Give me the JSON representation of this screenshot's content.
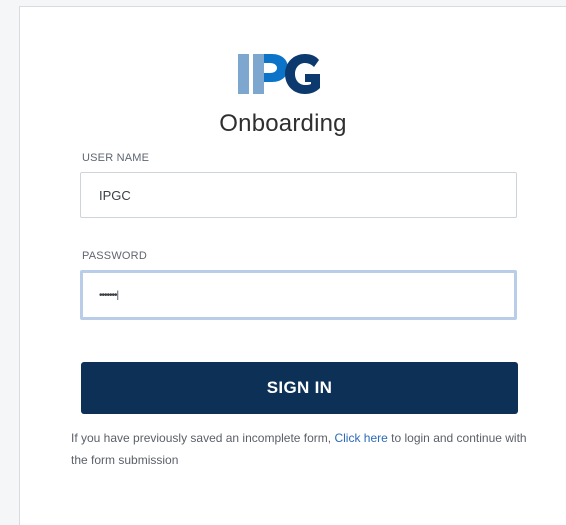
{
  "logo": {
    "text": "IPG",
    "colors": [
      "#7ea7cf",
      "#0b74c8",
      "#0c3a6e"
    ]
  },
  "app_title": "Onboarding",
  "form": {
    "username_label": "USER NAME",
    "username_value": "IPGC",
    "password_label": "PASSWORD",
    "password_value": "•••••••|",
    "sign_in_label": "SIGN IN"
  },
  "help": {
    "text_before": "If you have previously saved an incomplete form, ",
    "link_text": "Click here",
    "text_after": " to login and continue with the form submission"
  },
  "colors": {
    "primary": "#0c3056",
    "link": "#2b6ab8",
    "focus_border": "#b9cde8"
  }
}
